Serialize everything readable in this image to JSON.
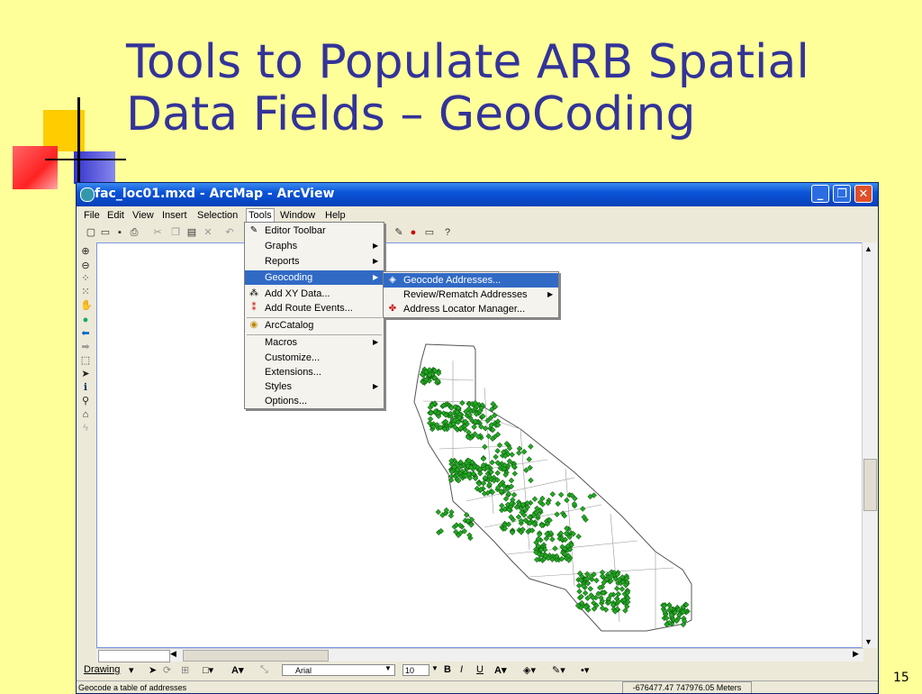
{
  "slide": {
    "title_line1": "Tools to Populate ARB Spatial",
    "title_line2": "Data Fields – GeoCoding",
    "page_number": "15"
  },
  "window": {
    "title": "fac_loc01.mxd - ArcMap - ArcView"
  },
  "menubar": {
    "items": [
      "File",
      "Edit",
      "View",
      "Insert",
      "Selection",
      "Tools",
      "Window",
      "Help"
    ]
  },
  "tools_menu": {
    "items": [
      {
        "label": "Editor Toolbar",
        "icon": "editor-icon"
      },
      {
        "label": "Graphs",
        "submenu": true
      },
      {
        "label": "Reports",
        "submenu": true
      },
      {
        "label": "Geocoding",
        "submenu": true,
        "highlighted": true
      },
      {
        "label": "Add XY Data...",
        "icon": "xy-icon"
      },
      {
        "label": "Add Route Events...",
        "icon": "route-icon"
      },
      {
        "label": "ArcCatalog",
        "icon": "arccatalog-icon"
      },
      {
        "label": "Macros",
        "submenu": true
      },
      {
        "label": "Customize..."
      },
      {
        "label": "Extensions..."
      },
      {
        "label": "Styles",
        "submenu": true
      },
      {
        "label": "Options..."
      }
    ]
  },
  "geocoding_submenu": {
    "items": [
      {
        "label": "Geocode Addresses...",
        "highlighted": true,
        "icon": "geocode-icon"
      },
      {
        "label": "Review/Rematch Addresses",
        "submenu": true
      },
      {
        "label": "Address Locator Manager...",
        "icon": "locator-icon"
      }
    ]
  },
  "drawing_toolbar": {
    "drawing_label": "Drawing",
    "font": "Arial",
    "font_size": "10",
    "bold": "B",
    "italic": "I",
    "underline": "U"
  },
  "status": {
    "message": "Geocode a table of addresses",
    "coordinates": "-676477.47  747976.05 Meters"
  },
  "colors": {
    "slide_bg": "#ffff99",
    "title": "#333399",
    "title_bar": "#0a54d8",
    "menu_highlight": "#316ac5",
    "point": "#22aa22"
  }
}
